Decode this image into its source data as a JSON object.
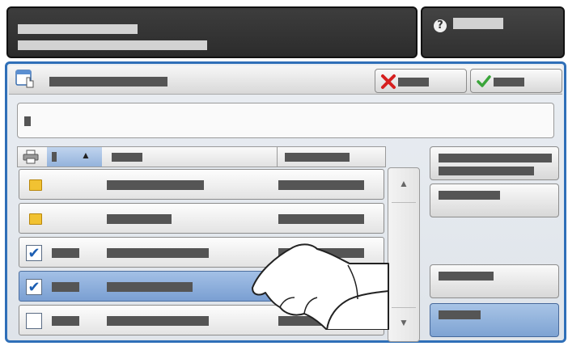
{
  "header": {
    "message_lines": [
      "",
      ""
    ],
    "help_label": ""
  },
  "panel": {
    "title": "",
    "cancel_label": "",
    "ok_label": "",
    "input_value": ""
  },
  "grid": {
    "columns": [
      "",
      "",
      ""
    ],
    "rows": [
      {
        "type": "folder",
        "checked": false,
        "selected": false
      },
      {
        "type": "folder",
        "checked": false,
        "selected": false
      },
      {
        "type": "file",
        "checked": true,
        "selected": false
      },
      {
        "type": "file",
        "checked": true,
        "selected": true
      },
      {
        "type": "file",
        "checked": false,
        "selected": false
      }
    ]
  },
  "side_buttons": [
    "",
    "",
    "",
    ""
  ],
  "icons": [
    "help-icon",
    "document-touch-icon",
    "cancel-x-icon",
    "ok-check-icon",
    "printer-icon",
    "sort-up-icon",
    "folder-icon",
    "checkbox-icon",
    "scroll-up-icon",
    "scroll-down-icon",
    "hand-pointer-icon"
  ]
}
